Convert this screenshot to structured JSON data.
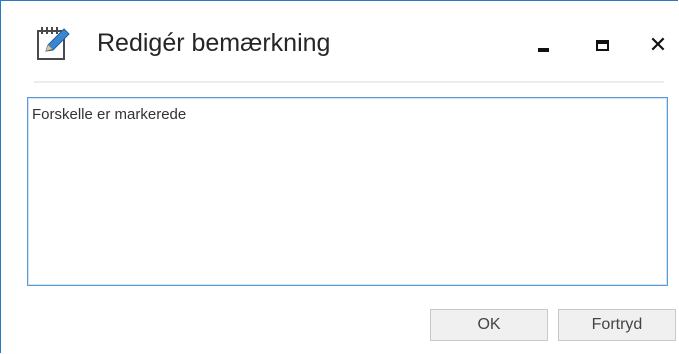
{
  "window": {
    "title": "Redigér bemærkning",
    "icon": "edit-note-icon",
    "minimize_icon": "minimize-icon",
    "maximize_icon": "maximize-icon",
    "close_icon": "close-icon",
    "close_glyph": "✕",
    "accent_color": "#2b79c2"
  },
  "note": {
    "value": "Forskelle er markerede"
  },
  "buttons": {
    "ok_label": "OK",
    "cancel_label": "Fortryd"
  }
}
